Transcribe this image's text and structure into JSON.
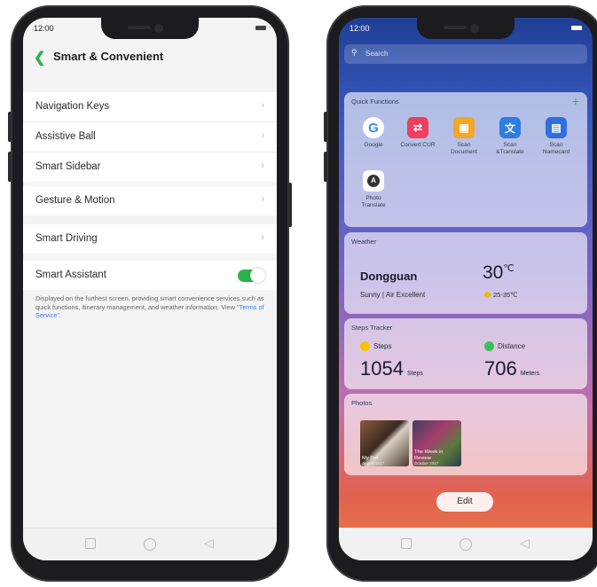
{
  "left_phone": {
    "status_time": "12:00",
    "header": {
      "back_icon": "chevron-left-icon",
      "title": "Smart & Convenient"
    },
    "groups": [
      {
        "items": [
          {
            "label": "Navigation Keys"
          },
          {
            "label": "Assistive Ball"
          },
          {
            "label": "Smart Sidebar"
          }
        ]
      },
      {
        "items": [
          {
            "label": "Gesture & Motion"
          }
        ]
      },
      {
        "items": [
          {
            "label": "Smart Driving"
          }
        ]
      }
    ],
    "smart_assistant": {
      "label": "Smart Assistant",
      "enabled": true,
      "description": "Displayed on the furthest screen, providing smart convenience services such as quick functions, itinerary management, and weather information. View ",
      "link": "\"Terms of Service\"",
      "suffix": "."
    },
    "accent": "#2bb34a"
  },
  "right_phone": {
    "status_time": "12:00",
    "search_placeholder": "Search",
    "quick_functions": {
      "title": "Quick Functions",
      "add_icon": "plus-icon",
      "items": [
        {
          "label": "Google",
          "icon": "google-icon",
          "color": "#ffffff"
        },
        {
          "label": "Convert CUR",
          "icon": "convert-icon",
          "color": "#ef3e5f"
        },
        {
          "label": "Scan Document",
          "icon": "scan-document-icon",
          "color": "#f5a623"
        },
        {
          "label": "Scan &Translate",
          "icon": "scan-translate-icon",
          "color": "#2f7de1"
        },
        {
          "label": "Scan Namecard",
          "icon": "namecard-icon",
          "color": "#2f6fe0"
        },
        {
          "label": "Photo Translate",
          "icon": "photo-translate-icon",
          "color": "#ffffff"
        }
      ]
    },
    "weather": {
      "title": "Weather",
      "city": "Dongguan",
      "condition": "Sunny  |  Air Excellent",
      "temp": "30",
      "unit": "℃",
      "range": "25-35℃"
    },
    "steps": {
      "title": "Steps Tracker",
      "steps_label": "Steps",
      "steps_value": "1054",
      "steps_unit": "Steps",
      "distance_label": "Distance",
      "distance_value": "706",
      "distance_unit": "Meters"
    },
    "photos": {
      "title": "Photos",
      "items": [
        {
          "title": "My Pet",
          "date": "August 2017"
        },
        {
          "title": "The Week in Review",
          "date": "October 2017"
        }
      ]
    },
    "edit_label": "Edit"
  }
}
